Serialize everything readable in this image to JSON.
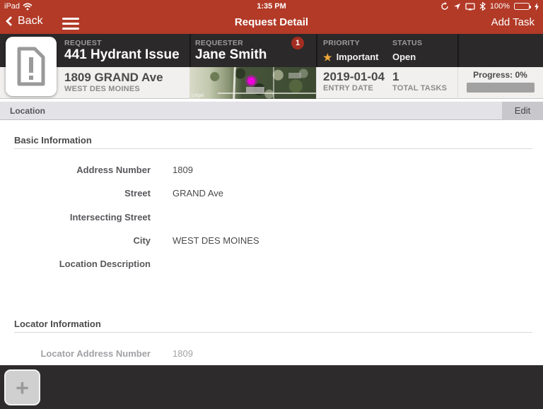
{
  "status_bar": {
    "carrier": "iPad",
    "time": "1:35 PM",
    "battery_percent": "100%"
  },
  "nav_bar": {
    "back_label": "Back",
    "title": "Request Detail",
    "add_task_label": "Add Task"
  },
  "summary": {
    "request": {
      "label": "REQUEST",
      "value": "441 Hydrant Issue"
    },
    "address": {
      "line1": "1809 GRAND Ave",
      "line2": "WEST DES MOINES"
    },
    "requester": {
      "label": "REQUESTER",
      "value": "Jane Smith",
      "badge_count": "1"
    },
    "priority": {
      "label": "PRIORITY",
      "value": "Important"
    },
    "status": {
      "label": "STATUS",
      "value": "Open"
    },
    "entry_date": {
      "value": "2019-01-04",
      "label": "ENTRY DATE"
    },
    "total_tasks": {
      "value": "1",
      "label": "TOTAL TASKS"
    },
    "progress": {
      "label": "Progress: 0%",
      "percent": 0
    },
    "map": {
      "legal": "Legal"
    }
  },
  "section_bar": {
    "title": "Location",
    "edit_label": "Edit"
  },
  "basic_information": {
    "title": "Basic Information",
    "fields": [
      {
        "label": "Address Number",
        "value": "1809"
      },
      {
        "label": "Street",
        "value": "GRAND Ave"
      },
      {
        "label": "Intersecting Street",
        "value": ""
      },
      {
        "label": "City",
        "value": "WEST DES MOINES"
      },
      {
        "label": "Location Description",
        "value": ""
      }
    ]
  },
  "locator_information": {
    "title": "Locator Information",
    "fields": [
      {
        "label": "Locator Address Number",
        "value": "1809"
      }
    ]
  },
  "icons": {
    "star": "★",
    "plus": "+"
  },
  "colors": {
    "nav_red": "#b23a27",
    "header_dark": "#2b292a",
    "badge_red": "#a32d20",
    "star_yellow": "#f0a93a",
    "bottom_bar": "#2d2b2c",
    "pin_magenta": "#ee00dd"
  }
}
